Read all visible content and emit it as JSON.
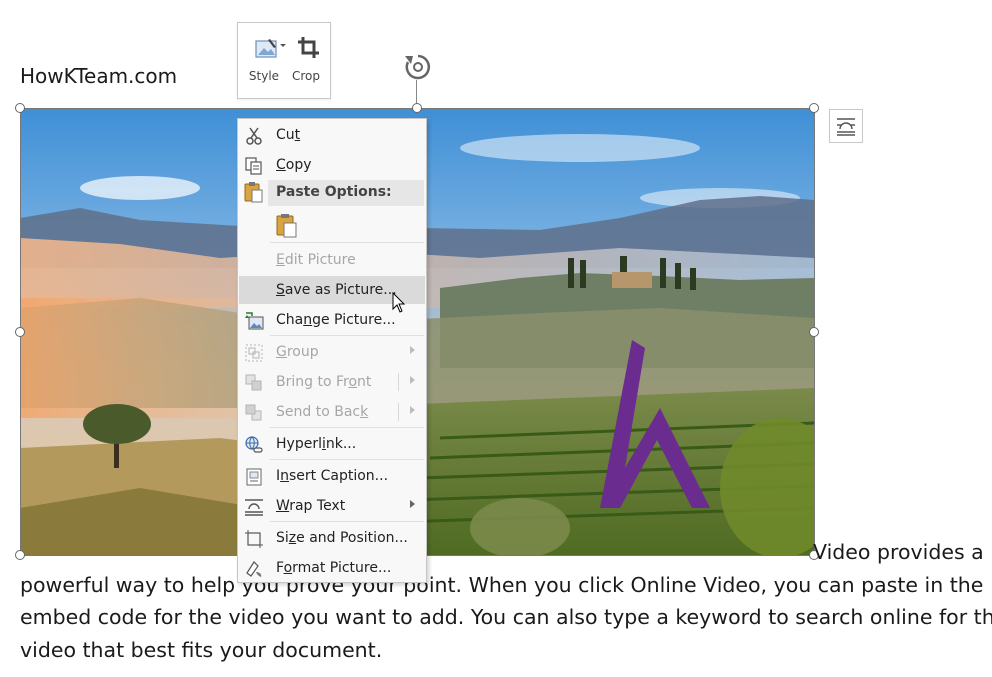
{
  "document": {
    "title": "HowKTeam.com",
    "body_lines": [
      "Video provides a",
      "powerful way to help you prove your point. When you click Online Video, you can paste in the",
      "embed code for the video you want to add. You can also type a keyword to search online for the",
      "video that best fits your document."
    ]
  },
  "mini_toolbar": {
    "style_label": "Style",
    "crop_label": "Crop"
  },
  "context_menu": {
    "cut": {
      "pre": "Cu",
      "ul": "t",
      "post": ""
    },
    "copy": {
      "pre": "",
      "ul": "C",
      "post": "opy"
    },
    "paste_options": "Paste Options:",
    "edit_picture": {
      "pre": "",
      "ul": "E",
      "post": "dit Picture"
    },
    "save_as_picture": {
      "pre": "",
      "ul": "S",
      "post": "ave as Picture..."
    },
    "change_picture": {
      "pre": "Cha",
      "ul": "n",
      "post": "ge Picture..."
    },
    "group": {
      "pre": "",
      "ul": "G",
      "post": "roup"
    },
    "bring_to_front": {
      "pre": "Bring to Fr",
      "ul": "o",
      "post": "nt"
    },
    "send_to_back": {
      "pre": "Send to Bac",
      "ul": "k",
      "post": ""
    },
    "hyperlink": {
      "pre": "Hyperl",
      "ul": "i",
      "post": "nk..."
    },
    "insert_caption": {
      "pre": "I",
      "ul": "n",
      "post": "sert Caption..."
    },
    "wrap_text": {
      "pre": "",
      "ul": "W",
      "post": "rap Text"
    },
    "size_position": {
      "pre": "Si",
      "ul": "z",
      "post": "e and Position..."
    },
    "format_picture": {
      "pre": "F",
      "ul": "o",
      "post": "rmat Picture..."
    }
  },
  "icons": [
    "scissors-icon",
    "copy-icon",
    "paste-icon",
    "clipboard-icon",
    "change-picture-icon",
    "group-icon",
    "bring-front-icon",
    "send-back-icon",
    "hyperlink-icon",
    "caption-icon",
    "wrap-text-icon",
    "size-position-icon",
    "format-picture-icon",
    "rotate-icon",
    "layout-options-icon",
    "style-icon",
    "crop-icon"
  ],
  "colors": {
    "logo_purple": "#6b2c8f",
    "menu_hover": "#dadada"
  }
}
